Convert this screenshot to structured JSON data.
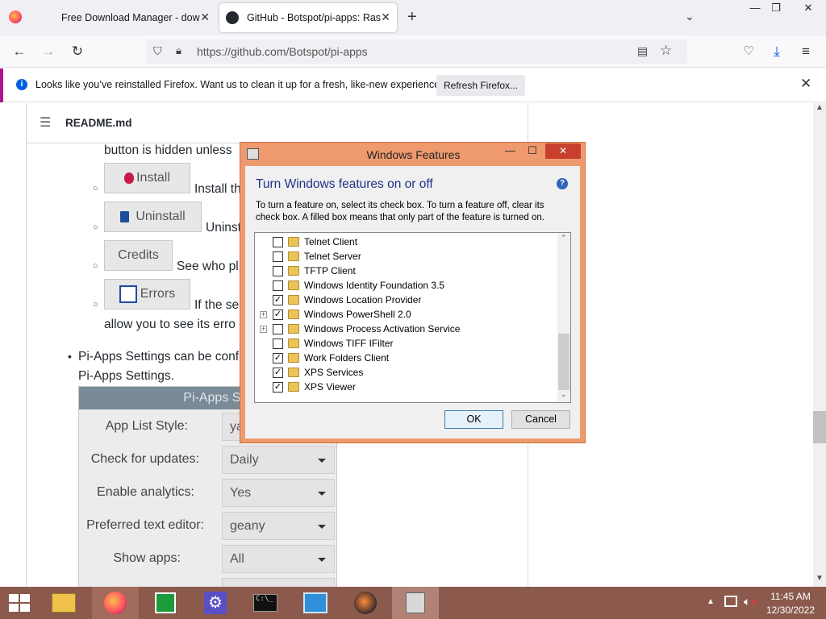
{
  "browser": {
    "tabs": [
      {
        "title": "Free Download Manager - dow"
      },
      {
        "title": "GitHub - Botspot/pi-apps: Rasp"
      }
    ],
    "url": "https://github.com/Botspot/pi-apps",
    "notification": {
      "message": "Looks like you’ve reinstalled Firefox. Want us to clean it up for a fresh, like-new experience?",
      "button": "Refresh Firefox..."
    }
  },
  "readme": {
    "header": "README.md",
    "text_hidden": "button is hidden unless",
    "buttons": [
      {
        "label": "Install",
        "after": "Install th"
      },
      {
        "label": "Uninstall",
        "after": "Uninst"
      },
      {
        "label": "Credits",
        "after": "See who pl"
      },
      {
        "label": "Errors",
        "after": "If the se"
      }
    ],
    "allow_text": "allow you to see its erro",
    "settings_line1": "Pi-Apps Settings can be conf",
    "settings_line2": "Pi-Apps Settings.",
    "settings_title": "Pi-Apps Settin",
    "settings": [
      {
        "label": "App List Style:",
        "value": "ya"
      },
      {
        "label": "Check for updates:",
        "value": "Daily"
      },
      {
        "label": "Enable analytics:",
        "value": "Yes"
      },
      {
        "label": "Preferred text editor:",
        "value": "geany"
      },
      {
        "label": "Show apps:",
        "value": "All"
      }
    ]
  },
  "dialog": {
    "title": "Windows Features",
    "heading": "Turn Windows features on or off",
    "description": "To turn a feature on, select its check box. To turn a feature off, clear its check box. A filled box means that only part of the feature is turned on.",
    "features": [
      {
        "name": "Telnet Client",
        "checked": false,
        "expand": false
      },
      {
        "name": "Telnet Server",
        "checked": false,
        "expand": false
      },
      {
        "name": "TFTP Client",
        "checked": false,
        "expand": false
      },
      {
        "name": "Windows Identity Foundation 3.5",
        "checked": false,
        "expand": false
      },
      {
        "name": "Windows Location Provider",
        "checked": true,
        "expand": false
      },
      {
        "name": "Windows PowerShell 2.0",
        "checked": true,
        "expand": true
      },
      {
        "name": "Windows Process Activation Service",
        "checked": false,
        "expand": true
      },
      {
        "name": "Windows TIFF IFilter",
        "checked": false,
        "expand": false
      },
      {
        "name": "Work Folders Client",
        "checked": true,
        "expand": false
      },
      {
        "name": "XPS Services",
        "checked": true,
        "expand": false
      },
      {
        "name": "XPS Viewer",
        "checked": true,
        "expand": false
      }
    ],
    "ok": "OK",
    "cancel": "Cancel"
  },
  "taskbar": {
    "time": "11:45 AM",
    "date": "12/30/2022"
  },
  "colors": {
    "dialog_frame": "#ef9a6e",
    "taskbar": "#8b5a4c",
    "settings_header": "#7b8a97",
    "notification_accent": "#b0138b",
    "dialog_heading": "#1e3287"
  }
}
